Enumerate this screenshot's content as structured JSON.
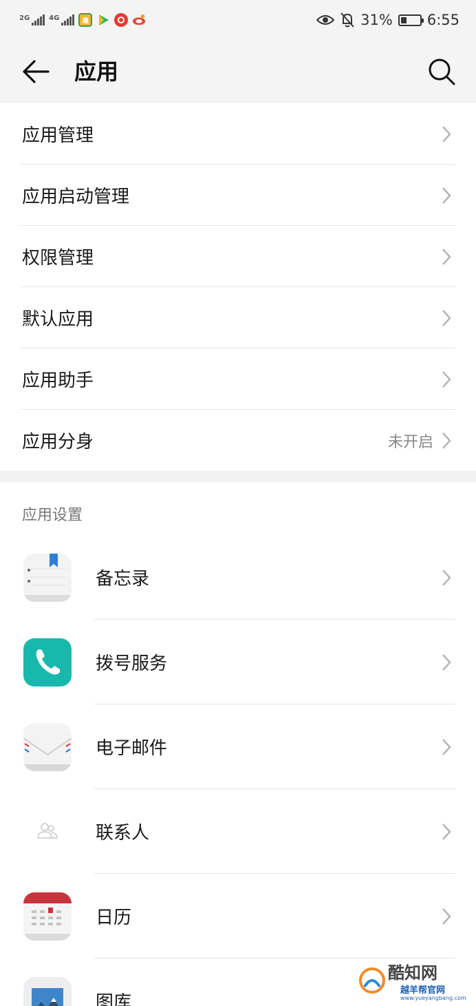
{
  "status_bar": {
    "sim1_label": "2G",
    "sim2_label": "4G",
    "battery_text": "31%",
    "time": "6:55",
    "notification_icons": [
      "reader-app-icon",
      "video-app-icon",
      "music-app-icon",
      "sina-app-icon"
    ]
  },
  "header": {
    "title": "应用"
  },
  "menu": {
    "items": [
      {
        "label": "应用管理",
        "value": ""
      },
      {
        "label": "应用启动管理",
        "value": ""
      },
      {
        "label": "权限管理",
        "value": ""
      },
      {
        "label": "默认应用",
        "value": ""
      },
      {
        "label": "应用助手",
        "value": ""
      },
      {
        "label": "应用分身",
        "value": "未开启"
      }
    ]
  },
  "app_settings": {
    "section_title": "应用设置",
    "apps": [
      {
        "label": "备忘录",
        "icon": "notepad-icon"
      },
      {
        "label": "拨号服务",
        "icon": "phone-icon"
      },
      {
        "label": "电子邮件",
        "icon": "mail-icon"
      },
      {
        "label": "联系人",
        "icon": "contacts-icon"
      },
      {
        "label": "日历",
        "icon": "calendar-icon"
      },
      {
        "label": "图库",
        "icon": "gallery-icon"
      }
    ]
  },
  "watermark": {
    "text1": "酷知网",
    "text2": "越羊帮官网",
    "url": "www.yueyangbang.com"
  },
  "colors": {
    "accent_teal": "#19b8ad",
    "calendar_red": "#c8343b",
    "notepad_blue": "#2f7fd8",
    "title_bar_bg": "#f4f4f4"
  }
}
